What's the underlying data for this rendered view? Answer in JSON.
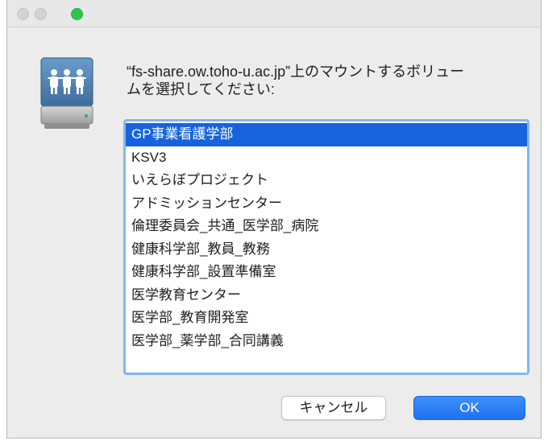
{
  "window": {
    "controls": {
      "close_color": "#d3d3d3",
      "minimize_color": "#d3d3d3",
      "zoom_color": "#2ac84a"
    }
  },
  "dialog": {
    "icon": "network-server-volume-icon",
    "prompt": "“fs-share.ow.toho-u.ac.jp”上のマウントするボリュー\nムを選択してください:",
    "volumes": [
      {
        "label": "GP事業看護学部",
        "selected": true
      },
      {
        "label": "KSV3",
        "selected": false
      },
      {
        "label": "いえらぼプロジェクト",
        "selected": false
      },
      {
        "label": "アドミッションセンター",
        "selected": false
      },
      {
        "label": "倫理委員会_共通_医学部_病院",
        "selected": false
      },
      {
        "label": "健康科学部_教員_教務",
        "selected": false
      },
      {
        "label": "健康科学部_設置準備室",
        "selected": false
      },
      {
        "label": "医学教育センター",
        "selected": false
      },
      {
        "label": "医学部_教育開発室",
        "selected": false
      },
      {
        "label": "医学部_薬学部_合同講義",
        "selected": false
      }
    ],
    "cancel_label": "キャンセル",
    "ok_label": "OK"
  },
  "colors": {
    "selection": "#1663dd",
    "focus_ring": "#86b4f5",
    "primary_button": "#1d72f0"
  }
}
